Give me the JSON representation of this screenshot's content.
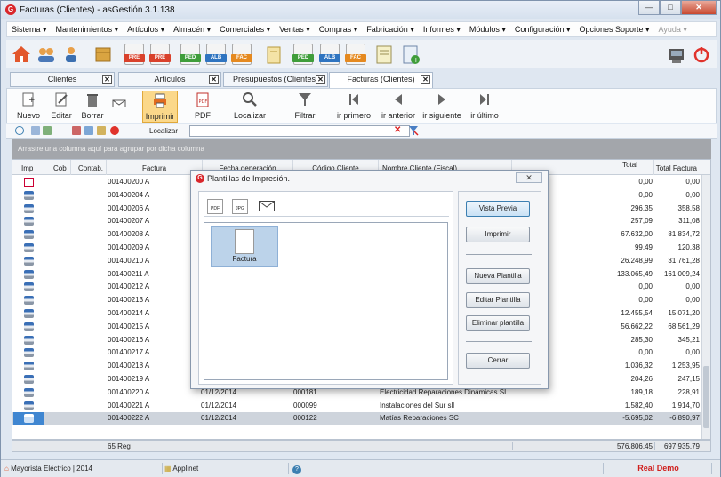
{
  "window": {
    "title": "Facturas (Clientes) - asGestión 3.1.138",
    "app_badge": "G"
  },
  "menu": [
    "Sistema ▾",
    "Mantenimientos ▾",
    "Artículos ▾",
    "Almacén ▾",
    "Comerciales ▾",
    "Ventas ▾",
    "Compras ▾",
    "Fabricación ▾",
    "Informes ▾",
    "Módulos ▾",
    "Configuración ▾",
    "Opciones Soporte ▾",
    "Ayuda ▾"
  ],
  "toolbar_icons": {
    "pre": "PRE",
    "ped": "PED",
    "alb": "ALB",
    "fac": "FAC"
  },
  "tabs": [
    {
      "label": "Clientes"
    },
    {
      "label": "Artículos"
    },
    {
      "label": "Presupuestos (Clientes)"
    },
    {
      "label": "Facturas (Clientes)"
    }
  ],
  "actions": {
    "nuevo": "Nuevo",
    "editar": "Editar",
    "borrar": "Borrar",
    "imprimir": "Imprimir",
    "pdf": "PDF",
    "localizar": "Localizar",
    "filtrar": "Filtrar",
    "primero": "ir primero",
    "anterior": "ir anterior",
    "siguiente": "ir siguiente",
    "ultimo": "ir último"
  },
  "search": {
    "label": "Localizar",
    "value": ""
  },
  "group_hint": "Arrastre una columna aquí para agrupar por dicha columna",
  "columns": {
    "imp": "Imp",
    "cob": "Cob",
    "contab": "Contab.",
    "factura": "Factura",
    "fecha": "Fecha generación",
    "codigo": "Código Cliente",
    "nombre": "Nombre Cliente (Fiscal)",
    "total": "Total",
    "total_factura": "Total Factura"
  },
  "rows": [
    {
      "icon": "pdf",
      "factura": "001400200 A",
      "fecha": "",
      "codigo": "",
      "nombre": "",
      "total": "0,00",
      "total_factura": "0,00"
    },
    {
      "icon": "printer",
      "factura": "001400204 A",
      "fecha": "",
      "codigo": "",
      "nombre": "",
      "total": "0,00",
      "total_factura": "0,00"
    },
    {
      "icon": "printer",
      "factura": "001400206 A",
      "fecha": "",
      "codigo": "",
      "nombre": "",
      "total": "296,35",
      "total_factura": "358,58"
    },
    {
      "icon": "printer",
      "factura": "001400207 A",
      "fecha": "",
      "codigo": "",
      "nombre": "",
      "total": "257,09",
      "total_factura": "311,08"
    },
    {
      "icon": "printer",
      "factura": "001400208 A",
      "fecha": "",
      "codigo": "",
      "nombre": "",
      "total": "67.632,00",
      "total_factura": "81.834,72"
    },
    {
      "icon": "printer",
      "factura": "001400209 A",
      "fecha": "",
      "codigo": "",
      "nombre": "",
      "total": "99,49",
      "total_factura": "120,38"
    },
    {
      "icon": "printer",
      "factura": "001400210 A",
      "fecha": "",
      "codigo": "",
      "nombre": "",
      "total": "26.248,99",
      "total_factura": "31.761,28"
    },
    {
      "icon": "printer",
      "factura": "001400211 A",
      "fecha": "",
      "codigo": "",
      "nombre": "",
      "total": "133.065,49",
      "total_factura": "161.009,24"
    },
    {
      "icon": "printer",
      "factura": "001400212 A",
      "fecha": "",
      "codigo": "",
      "nombre": "",
      "total": "0,00",
      "total_factura": "0,00"
    },
    {
      "icon": "printer",
      "factura": "001400213 A",
      "fecha": "",
      "codigo": "",
      "nombre": "",
      "total": "0,00",
      "total_factura": "0,00"
    },
    {
      "icon": "printer",
      "factura": "001400214 A",
      "fecha": "",
      "codigo": "",
      "nombre": "",
      "total": "12.455,54",
      "total_factura": "15.071,20"
    },
    {
      "icon": "printer",
      "factura": "001400215 A",
      "fecha": "",
      "codigo": "",
      "nombre": "",
      "total": "56.662,22",
      "total_factura": "68.561,29"
    },
    {
      "icon": "printer",
      "factura": "001400216 A",
      "fecha": "",
      "codigo": "",
      "nombre": "",
      "total": "285,30",
      "total_factura": "345,21"
    },
    {
      "icon": "printer",
      "factura": "001400217 A",
      "fecha": "",
      "codigo": "",
      "nombre": "",
      "total": "0,00",
      "total_factura": "0,00"
    },
    {
      "icon": "printer",
      "factura": "001400218 A",
      "fecha": "",
      "codigo": "",
      "nombre": "",
      "total": "1.036,32",
      "total_factura": "1.253,95"
    },
    {
      "icon": "printer",
      "factura": "001400219 A",
      "fecha": "",
      "codigo": "",
      "nombre": "",
      "total": "204,26",
      "total_factura": "247,15"
    },
    {
      "icon": "printer",
      "factura": "001400220 A",
      "fecha": "01/12/2014",
      "codigo": "000181",
      "nombre": "Electricidad Reparaciones Dinámicas SL",
      "total": "189,18",
      "total_factura": "228,91"
    },
    {
      "icon": "printer",
      "factura": "001400221 A",
      "fecha": "01/12/2014",
      "codigo": "000099",
      "nombre": "Instalaciones del Sur sll",
      "total": "1.582,40",
      "total_factura": "1.914,70"
    },
    {
      "icon": "printer",
      "factura": "001400222 A",
      "fecha": "01/12/2014",
      "codigo": "000122",
      "nombre": "Matías Reparaciones SC",
      "total": "-5.695,02",
      "total_factura": "-6.890,97"
    }
  ],
  "footer": {
    "count": "65 Reg",
    "total": "576.806,45",
    "total_factura": "697.935,79"
  },
  "status": {
    "company": "Mayorista Eléctrico | 2014",
    "applinet": "Applinet",
    "help": "?",
    "mode": "Real Demo"
  },
  "dialog": {
    "title": "Plantillas de Impresión.",
    "close": "✕",
    "tool_pdf": "PDF",
    "tool_jpg": "JPG",
    "template": "Factura",
    "vista_previa": "Vista Previa",
    "imprimir": "Imprimir",
    "nueva": "Nueva Plantilla",
    "editar": "Editar Plantilla",
    "eliminar": "Eliminar plantilla",
    "cerrar": "Cerrar"
  }
}
